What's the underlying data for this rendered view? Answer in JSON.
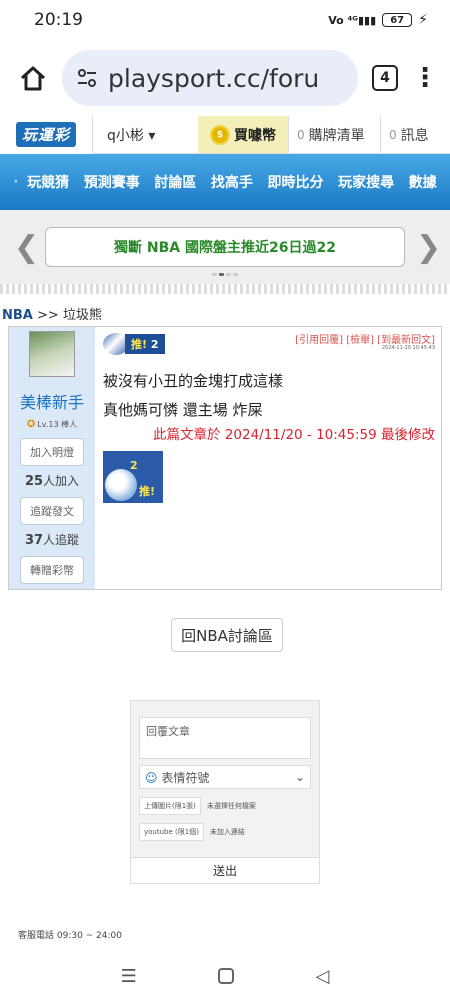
{
  "status_bar": {
    "time": "20:19",
    "network": "4G",
    "battery": "67"
  },
  "browser": {
    "url": "playsport.cc/foru",
    "tab_count": "4",
    "home_icon": "home-icon",
    "menu_icon": "more-vert-icon"
  },
  "site_header": {
    "logo": "玩運彩",
    "user": "q小彬 ▾",
    "coin_label": "買噱幣",
    "cart_count": "0",
    "cart_label": "購牌清單",
    "msg_count": "0",
    "msg_label": "訊息"
  },
  "nav": {
    "items": [
      "玩競猜",
      "預測賽事",
      "討論區",
      "找高手",
      "即時比分",
      "玩家搜尋",
      "數據"
    ]
  },
  "ticker": {
    "text": "獨斷 NBA 國際盤主推近26日過22"
  },
  "breadcrumb": {
    "category": "NBA",
    "sep": ">>",
    "title": "垃圾熊"
  },
  "post": {
    "author": "美棒新手",
    "level": "Lv.13 棒人",
    "follow_btn": "加入明燈",
    "follow_count": "25",
    "follow_suffix": "人加入",
    "track_btn": "追蹤發文",
    "track_count": "37",
    "track_suffix": "人追蹤",
    "gift_btn": "轉贈彩幣",
    "push_label": "推!",
    "push_count": "2",
    "links": "[引用回覆] [檢舉] [到最新回文]",
    "time_small": "2024-11-20 10:45:43",
    "line1": "被沒有小丑的金塊打成這樣",
    "line2": "真他媽可憐 還主場 炸屎",
    "edit_note": "此篇文章於 2024/11/20 - 10:45:59 最後修改",
    "push_big_count": "2",
    "push_big_label": "推!"
  },
  "back_button": "回NBA討論區",
  "reply_form": {
    "placeholder": "回覆文章",
    "emoji_label": "表情符號",
    "upload_image_label": "上傳圖片(限1張)",
    "upload_image_status": "未選擇任何檔案",
    "youtube_label": "youtube (限1個)",
    "youtube_status": "未加入連結",
    "submit": "送出"
  },
  "footer": {
    "phone": "客服電話 09:30 ~ 24:00"
  }
}
